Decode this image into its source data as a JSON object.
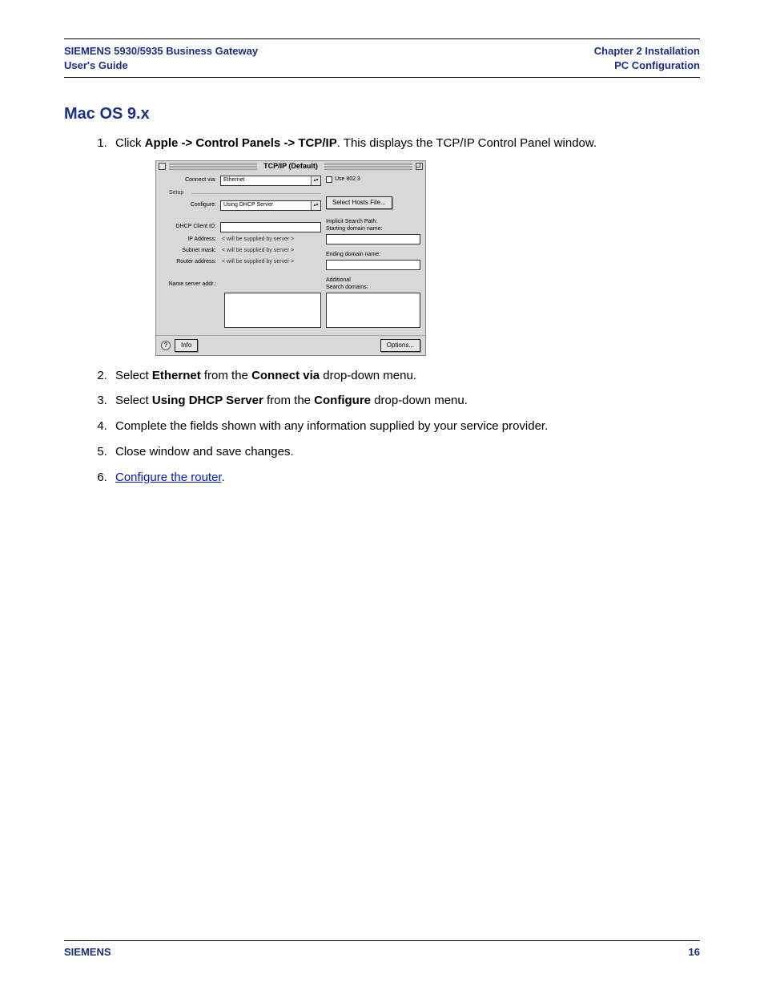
{
  "header": {
    "left_line1": "SIEMENS 5930/5935 Business Gateway",
    "left_line2": "User's Guide",
    "right_line1": "Chapter 2  Installation",
    "right_line2": "PC Configuration"
  },
  "section_heading": "Mac OS 9.x",
  "steps": {
    "s1_prefix": "Click ",
    "s1_bold": "Apple -> Control Panels -> TCP/IP",
    "s1_suffix": ". This displays the TCP/IP Control Panel window.",
    "s2_prefix": "Select ",
    "s2_b1": "Ethernet",
    "s2_mid": " from the ",
    "s2_b2": "Connect via",
    "s2_suffix": " drop-down menu.",
    "s3_prefix": "Select ",
    "s3_b1": "Using DHCP Server",
    "s3_mid": " from the ",
    "s3_b2": "Configure",
    "s3_suffix": " drop-down menu.",
    "s4": "Complete the fields shown with any information supplied by your service provider.",
    "s5": "Close window and save changes.",
    "s6_link": "Configure the router",
    "s6_suffix": "."
  },
  "panel": {
    "title": "TCP/IP (Default)",
    "connect_via_lbl": "Connect via:",
    "connect_via_val": "Ethernet",
    "setup_lbl": "Setup",
    "configure_lbl": "Configure:",
    "configure_val": "Using DHCP Server",
    "dhcp_client_lbl": "DHCP Client ID:",
    "ip_lbl": "IP Address:",
    "subnet_lbl": "Subnet mask:",
    "router_lbl": "Router address:",
    "ns_lbl": "Name server addr.:",
    "supplied": "< will be supplied by server >",
    "use8023": "Use 802.3",
    "select_hosts": "Select Hosts File...",
    "implicit_lbl": "Implicit Search Path:",
    "starting_lbl": "Starting domain name:",
    "ending_lbl": "Ending domain name:",
    "additional_lbl": "Additional",
    "searchdom_lbl": "Search domains:",
    "info_btn": "Info",
    "options_btn": "Options..."
  },
  "footer": {
    "brand": "SIEMENS",
    "page": "16"
  }
}
